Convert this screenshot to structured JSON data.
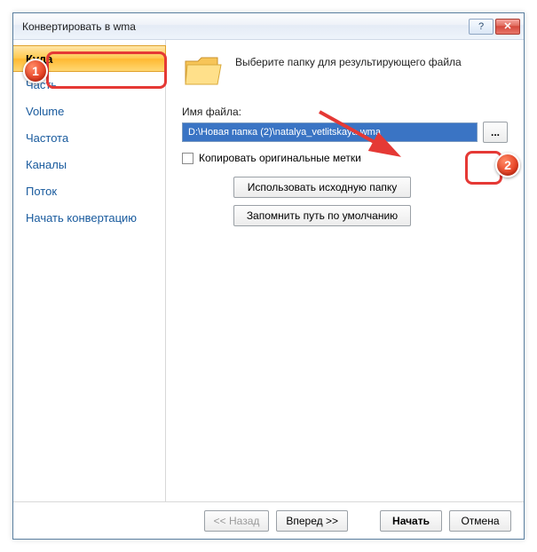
{
  "window": {
    "title": "Конвертировать в wma",
    "help_label": "?",
    "close_label": "✕"
  },
  "sidebar": {
    "items": [
      {
        "label": "Куда",
        "active": true
      },
      {
        "label": "Часть",
        "active": false
      },
      {
        "label": "Volume",
        "active": false
      },
      {
        "label": "Частота",
        "active": false
      },
      {
        "label": "Каналы",
        "active": false
      },
      {
        "label": "Поток",
        "active": false
      },
      {
        "label": "Начать конвертацию",
        "active": false
      }
    ]
  },
  "main": {
    "heading": "Выберите папку для результирующего файла",
    "filename_label": "Имя файла:",
    "path_value": "D:\\Новая папка (2)\\natalya_vetlitskaya.wma",
    "browse_label": "...",
    "copy_tags_label": "Копировать оригинальные метки",
    "use_source_folder_label": "Использовать исходную папку",
    "remember_default_label": "Запомнить путь по умолчанию"
  },
  "footer": {
    "back_label": "<< Назад",
    "forward_label": "Вперед >>",
    "start_label": "Начать",
    "cancel_label": "Отмена"
  },
  "annotations": {
    "marker1": "1",
    "marker2": "2"
  }
}
